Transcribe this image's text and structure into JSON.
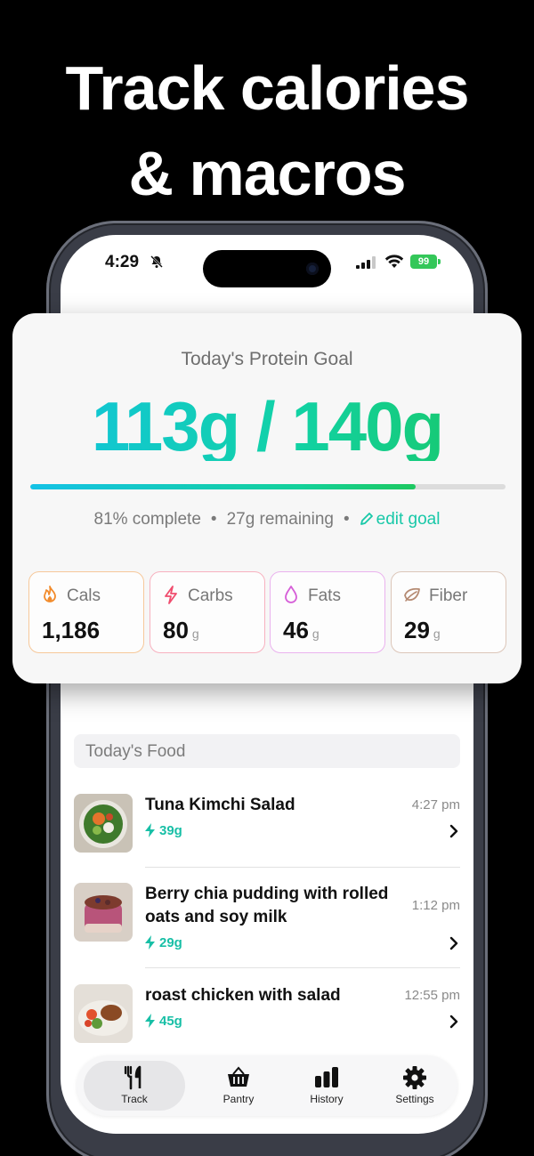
{
  "headline": {
    "line1": "Track calories",
    "line2": "& macros"
  },
  "status_bar": {
    "time": "4:29",
    "battery": "99"
  },
  "protein_card": {
    "title": "Today's Protein Goal",
    "current": "113g",
    "separator": "/",
    "goal": "140g",
    "progress": 0.81,
    "percent_text": "81% complete",
    "remaining_text": "27g remaining",
    "dot": "•",
    "edit_label": "edit goal"
  },
  "macros": [
    {
      "label": "Cals",
      "value": "1,186",
      "unit": "",
      "icon": "flame-icon",
      "color": "#f28b2b"
    },
    {
      "label": "Carbs",
      "value": "80",
      "unit": "g",
      "icon": "bolt-icon",
      "color": "#f04d6e"
    },
    {
      "label": "Fats",
      "value": "46",
      "unit": "g",
      "icon": "drop-icon",
      "color": "#d65fd8"
    },
    {
      "label": "Fiber",
      "value": "29",
      "unit": "g",
      "icon": "leaf-icon",
      "color": "#b58a72"
    }
  ],
  "food_section": {
    "title": "Today's Food",
    "items": [
      {
        "name": "Tuna Kimchi Salad",
        "time": "4:27 pm",
        "protein": "39g"
      },
      {
        "name": "Berry chia pudding with rolled oats and soy milk",
        "time": "1:12 pm",
        "protein": "29g"
      },
      {
        "name": "roast chicken with salad",
        "time": "12:55 pm",
        "protein": "45g"
      }
    ]
  },
  "tabs": [
    {
      "label": "Track",
      "icon": "fork-knife-icon",
      "active": true
    },
    {
      "label": "Pantry",
      "icon": "basket-icon",
      "active": false
    },
    {
      "label": "History",
      "icon": "bar-chart-icon",
      "active": false
    },
    {
      "label": "Settings",
      "icon": "gear-icon",
      "active": false
    }
  ],
  "colors": {
    "accent": "#18c8a8",
    "gradient_start": "#11c2e3",
    "gradient_end": "#18c65f"
  }
}
